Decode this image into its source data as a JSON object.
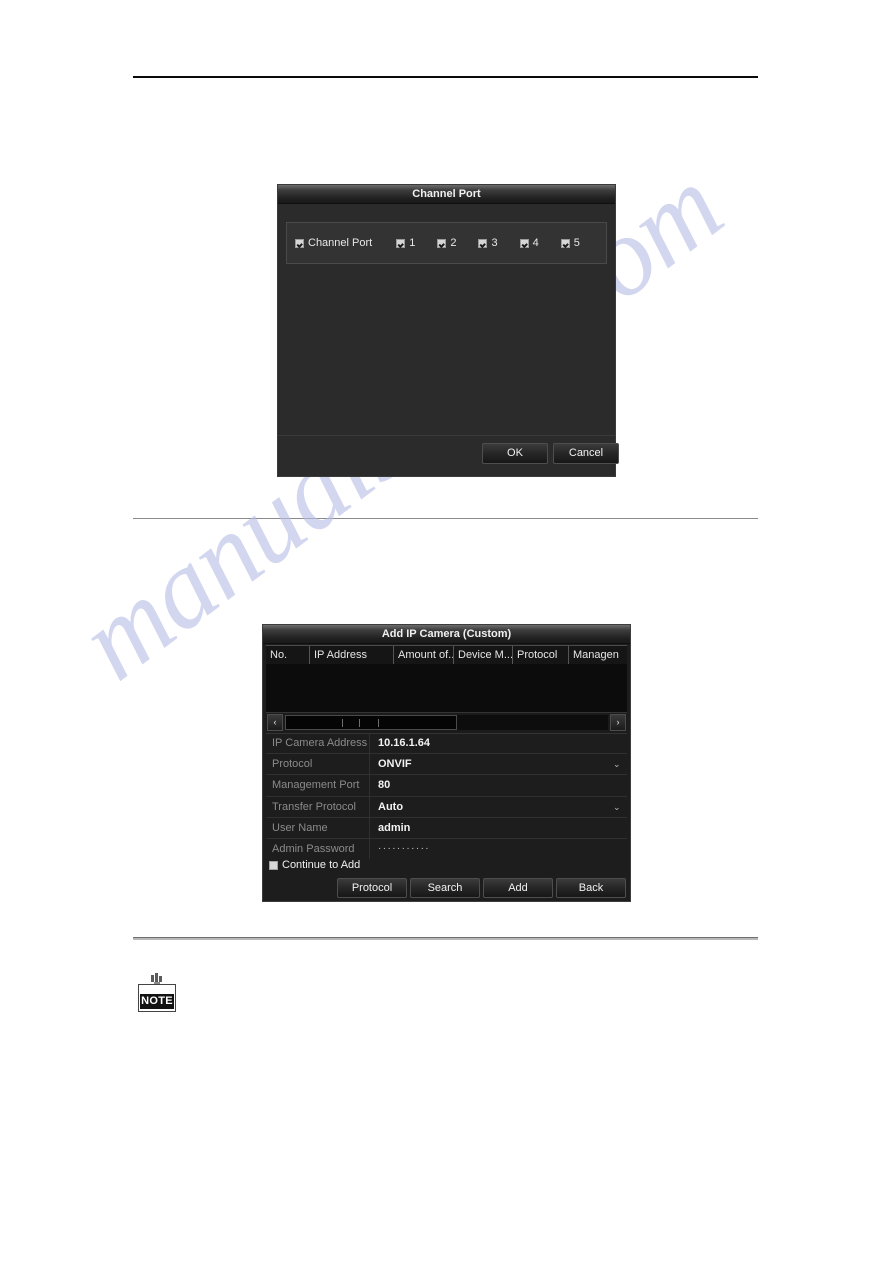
{
  "page": {
    "watermark": "manualshive.com"
  },
  "channel_port_dialog": {
    "title": "Channel Port",
    "items": [
      {
        "label": "Channel Port",
        "checked": true
      },
      {
        "label": "1",
        "checked": true
      },
      {
        "label": "2",
        "checked": true
      },
      {
        "label": "3",
        "checked": true
      },
      {
        "label": "4",
        "checked": true
      },
      {
        "label": "5",
        "checked": true
      }
    ],
    "ok_label": "OK",
    "cancel_label": "Cancel"
  },
  "add_ip_camera_dialog": {
    "title": "Add IP Camera (Custom)",
    "columns": [
      "No.",
      "IP Address",
      "Amount of...",
      "Device M...",
      "Protocol",
      "Managen"
    ],
    "rows": [],
    "scroll": {
      "left_arrow": "‹",
      "right_arrow": "›"
    },
    "form": [
      {
        "label": "IP Camera Address",
        "value": "10.16.1.64",
        "type": "text"
      },
      {
        "label": "Protocol",
        "value": "ONVIF",
        "type": "select"
      },
      {
        "label": "Management Port",
        "value": "80",
        "type": "text"
      },
      {
        "label": "Transfer Protocol",
        "value": "Auto",
        "type": "select"
      },
      {
        "label": "User Name",
        "value": "admin",
        "type": "text"
      },
      {
        "label": "Admin Password",
        "value": "···········",
        "type": "password"
      }
    ],
    "continue_to_add": {
      "label": "Continue to Add",
      "checked": false
    },
    "buttons": [
      "Protocol",
      "Search",
      "Add",
      "Back"
    ]
  },
  "note": {
    "label": "NOTE"
  }
}
